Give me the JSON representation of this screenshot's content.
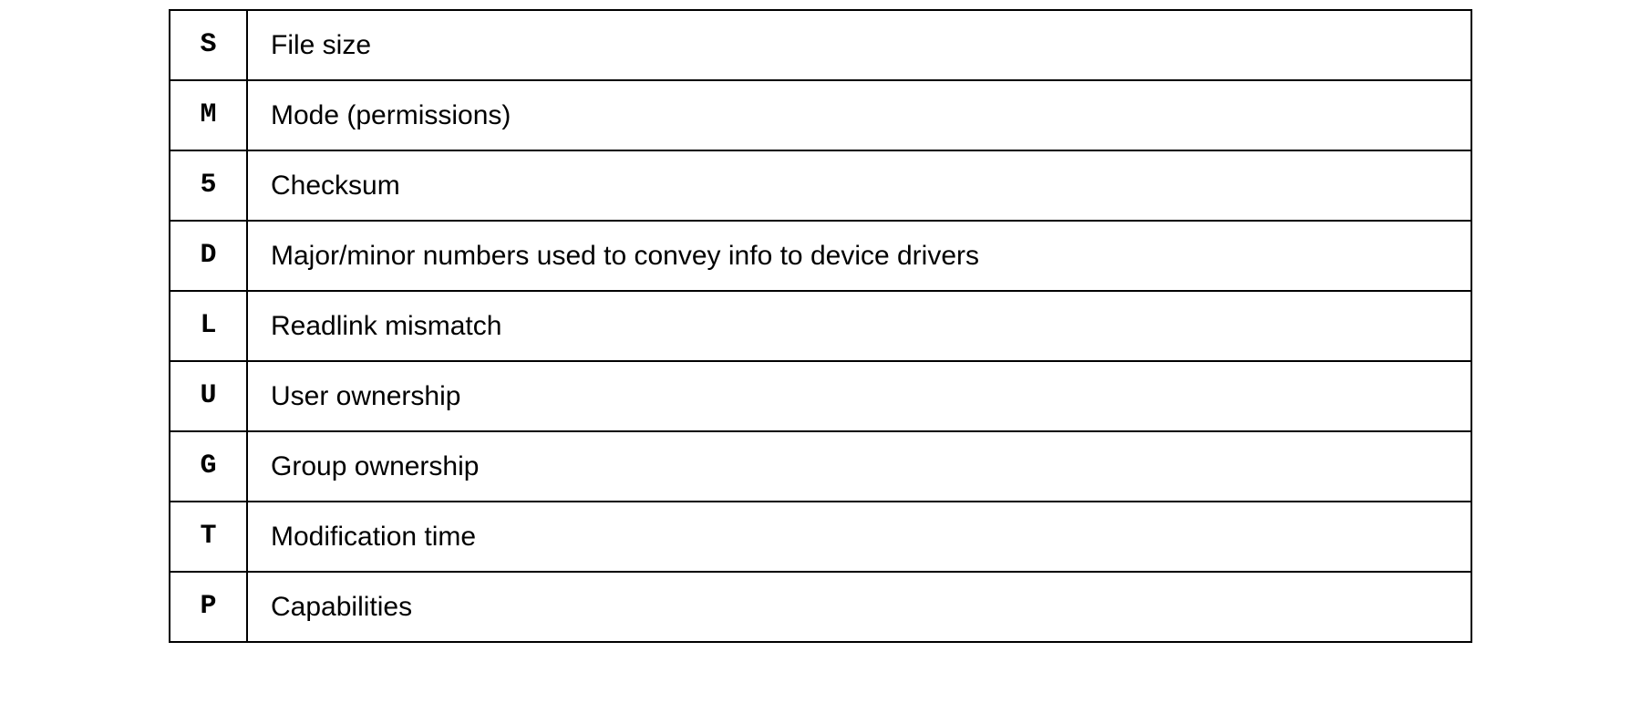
{
  "rows": [
    {
      "code": "S",
      "description": "File size"
    },
    {
      "code": "M",
      "description": "Mode (permissions)"
    },
    {
      "code": "5",
      "description": "Checksum"
    },
    {
      "code": "D",
      "description": "Major/minor numbers used to convey info to device drivers"
    },
    {
      "code": "L",
      "description": "Readlink mismatch"
    },
    {
      "code": "U",
      "description": "User ownership"
    },
    {
      "code": "G",
      "description": "Group ownership"
    },
    {
      "code": "T",
      "description": "Modification time"
    },
    {
      "code": "P",
      "description": "Capabilities"
    }
  ]
}
